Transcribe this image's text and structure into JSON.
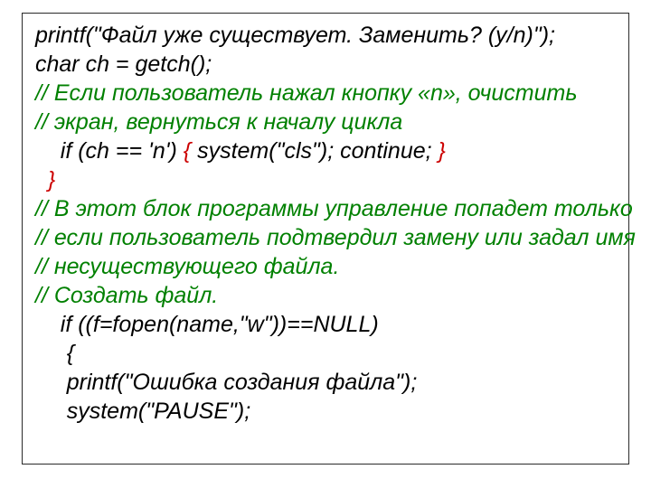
{
  "code": {
    "l1": "printf(\"Файл уже существует. Заменить? (y/n)\");",
    "l2": "char ch = getch();",
    "l3": "// Если пользователь нажал кнопку «n», очистить",
    "l4": "// экран, вернуться к началу цикла",
    "l5_pre": "    if (ch == 'n') ",
    "l5_open": "{",
    "l5_body": " system(\"cls\"); continue; ",
    "l5_close": "}",
    "l6_indent": "  ",
    "l6_close": "}",
    "l7": "// В этот блок программы управление попадет только",
    "l8": "// если пользователь подтвердил замену или задал имя",
    "l9": "// несуществующего файла.",
    "l10": "// Создать файл.",
    "l11": "    if ((f=fopen(name,\"w\"))==NULL)",
    "l12": "     {",
    "l13": "     printf(\"Ошибка создания файла\");",
    "l14": "     system(\"PAUSE\");"
  }
}
